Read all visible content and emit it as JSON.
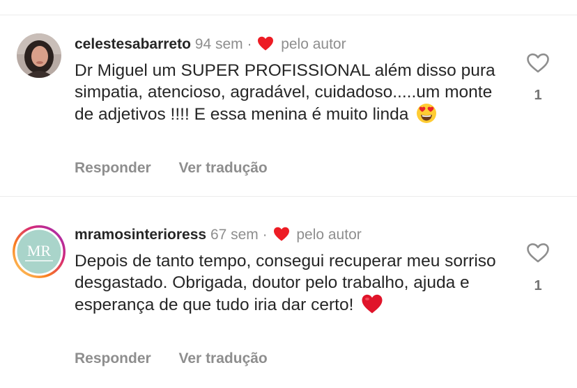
{
  "comments": [
    {
      "username": "celestesabarreto",
      "time": "94 sem",
      "separator": "·",
      "liked_by_author": "pelo autor",
      "text": "Dr Miguel um SUPER PROFISSIONAL além disso pura simpatia, atencioso, agradável, cuidadoso.....um monte de adjetivos !!!! E essa menina é  muito linda",
      "emoji": "heart-eyes-emoji",
      "reply_label": "Responder",
      "translate_label": "Ver tradução",
      "like_count": "1"
    },
    {
      "username": "mramosinterioress",
      "time": "67 sem",
      "separator": "·",
      "liked_by_author": "pelo autor",
      "text": "Depois de tanto tempo, consegui recuperar meu sorriso desgastado. Obrigada, doutor pelo trabalho, ajuda e esperança de que tudo iria dar certo!",
      "emoji": "red-heart-emoji",
      "reply_label": "Responder",
      "translate_label": "Ver tradução",
      "like_count": "1"
    }
  ],
  "colors": {
    "text": "#262626",
    "muted": "#8e8e8e",
    "heart_red": "#ed1c24",
    "divider": "#ececec"
  }
}
